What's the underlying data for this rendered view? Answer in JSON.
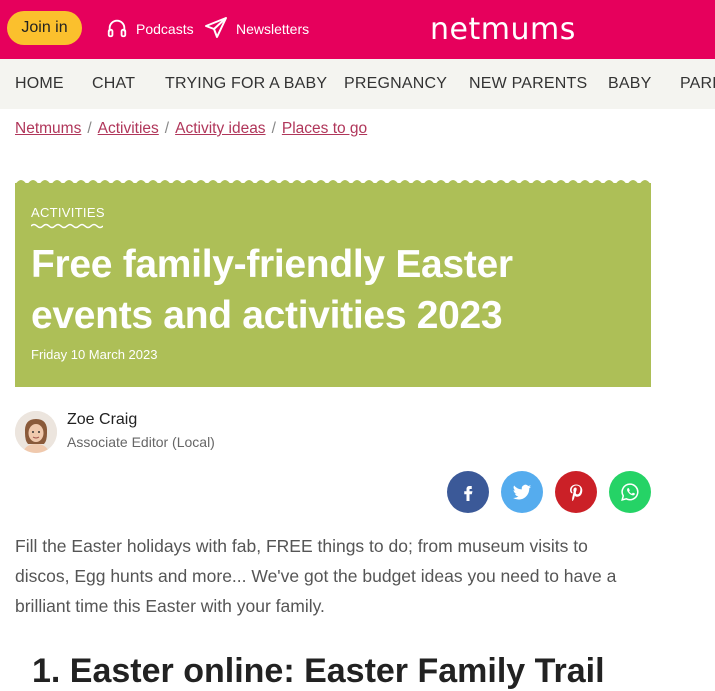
{
  "topbar": {
    "join_label": "Join in",
    "podcasts_label": "Podcasts",
    "newsletters_label": "Newsletters",
    "logo_text": "netmums",
    "brand_color": "#e6005c",
    "join_color": "#fbc02d"
  },
  "nav": {
    "items": [
      "HOME",
      "CHAT",
      "TRYING FOR A BABY",
      "PREGNANCY",
      "NEW PARENTS",
      "BABY",
      "PARENTING"
    ]
  },
  "breadcrumb": {
    "items": [
      "Netmums",
      "Activities",
      "Activity ideas",
      "Places to go"
    ],
    "separator": "/"
  },
  "hero": {
    "category": "ACTIVITIES",
    "title": "Free family-friendly Easter events and activities 2023",
    "date": "Friday 10 March 2023",
    "bg_color": "#adbf57"
  },
  "author": {
    "name": "Zoe Craig",
    "role": "Associate Editor (Local)"
  },
  "share": {
    "icons": [
      "facebook-icon",
      "twitter-icon",
      "pinterest-icon",
      "whatsapp-icon"
    ],
    "colors": [
      "#3b5998",
      "#55acee",
      "#cb2027",
      "#25d366"
    ]
  },
  "article": {
    "intro": "Fill the Easter holidays with fab, FREE things to do; from museum visits to discos, Egg hunts and more... We've got the budget ideas you need to have a brilliant time this Easter with your family.",
    "first_heading": "1. Easter online: Easter Family Trail"
  }
}
